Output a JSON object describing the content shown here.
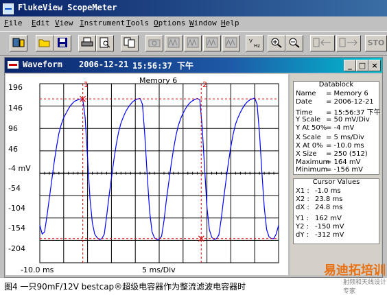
{
  "app": {
    "title": "FlukeView ScopeMeter"
  },
  "menu": [
    "File",
    "Edit",
    "View",
    "Instrument",
    "Tools",
    "Options",
    "Window",
    "Help"
  ],
  "toolbar": {
    "buttons": [
      "instrument-icon",
      "open-icon",
      "save-icon",
      "print-icon",
      "print-preview-icon",
      "copy-icon",
      "camera-icon",
      "waveform-icon",
      "waveform-icon",
      "waveform-icon",
      "waveform-icon",
      "waveform-icon",
      "waveform-icon",
      "vhz-icon",
      "zoom-in-icon",
      "zoom-out-icon",
      "left-arrow-icon",
      "right-arrow-icon"
    ],
    "stop_label": "STO"
  },
  "waveform_window": {
    "title": "Waveform",
    "date": "2006-12-21",
    "time": "15:56:37 下午",
    "controls": {
      "minimize": "_",
      "maximize": "□",
      "close": "×"
    }
  },
  "chart_data": {
    "type": "line",
    "title": "Memory 6",
    "xlabel": "5 ms/Div",
    "x_start_label": "-10.0 ms",
    "y_ticks": [
      "196",
      "146",
      "96",
      "46",
      "-4 mV",
      "-54",
      "-104",
      "-154",
      "-204"
    ],
    "ylim": [
      -204,
      196
    ],
    "xlim_ms": [
      -10,
      40
    ],
    "cursor_labels": [
      "1",
      "2"
    ],
    "cursors": [
      {
        "label": "1",
        "x_ms": -1.0,
        "y_mV": 162
      },
      {
        "label": "2",
        "x_ms": 23.8,
        "y_mV": -150
      }
    ],
    "series": [
      {
        "x": [
          -10,
          -9.5,
          -9,
          -8.5,
          -8,
          -7.5,
          -7,
          -6.5,
          -6,
          -5.5,
          -5,
          -4.5,
          -4,
          -3.5,
          -3,
          -2.5,
          -2,
          -1.5,
          -1,
          -0.5,
          0,
          0.5,
          1,
          1.5,
          2,
          2.5,
          3,
          3.5,
          4,
          4.5,
          5,
          5.5,
          6,
          6.5,
          7,
          7.5,
          8,
          8.5,
          9,
          9.5,
          10,
          10.5,
          11,
          11.5,
          12,
          12.5,
          13,
          13.5,
          14,
          14.5,
          15,
          15.5,
          16,
          16.5,
          17,
          17.5,
          18,
          18.5,
          19,
          19.5,
          20,
          20.5,
          21,
          21.5,
          22,
          22.5,
          23,
          23.5,
          24,
          24.5,
          25,
          25.5,
          26,
          26.5,
          27,
          27.5,
          28,
          28.5,
          29,
          29.5,
          30,
          30.5,
          31,
          31.5,
          32,
          32.5,
          33,
          33.5,
          34,
          34.5,
          35,
          35.5,
          36,
          36.5,
          37,
          37.5,
          38,
          38.5,
          39,
          39.5,
          40
        ],
        "y": [
          -120,
          -140,
          -135,
          -100,
          -60,
          -20,
          20,
          55,
          85,
          105,
          120,
          130,
          140,
          148,
          154,
          158,
          160,
          162,
          162,
          120,
          30,
          -60,
          -115,
          -140,
          -148,
          -152,
          -150,
          -140,
          -100,
          -55,
          -15,
          25,
          60,
          88,
          108,
          122,
          134,
          143,
          150,
          156,
          160,
          162,
          163,
          150,
          80,
          -10,
          -90,
          -135,
          -148,
          -152,
          -151,
          -145,
          -110,
          -65,
          -25,
          15,
          50,
          80,
          102,
          118,
          130,
          140,
          148,
          154,
          158,
          161,
          163,
          160,
          100,
          10,
          -80,
          -130,
          -147,
          -152,
          -150,
          -142,
          -105,
          -60,
          -20,
          20,
          55,
          84,
          106,
          120,
          132,
          142,
          150,
          156,
          160,
          162,
          164,
          150,
          85,
          0,
          -80,
          -130,
          -146,
          -150,
          -150,
          -140,
          -120
        ]
      }
    ]
  },
  "datablock": {
    "title": "Datablock",
    "rows": [
      [
        "Name",
        "= Memory 6"
      ],
      [
        "Date",
        "= 2006-12-21"
      ],
      [
        "Time",
        "= 15:56:37 下午"
      ],
      [
        "Y Scale",
        "=   50  mV/Div"
      ],
      [
        "Y At 50%",
        "=   -4   mV"
      ],
      [
        "X Scale",
        "=    5   ms/Div"
      ],
      [
        "X At 0%",
        "= -10.0 ms"
      ],
      [
        "X Size",
        "= 250 (512)"
      ],
      [
        "Maximum",
        "= 164  mV"
      ],
      [
        "Minimum",
        "= -156  mV"
      ]
    ]
  },
  "cursor_values": {
    "title": "Cursor Values",
    "rows": [
      [
        "X1 :",
        "-1.0 ms"
      ],
      [
        "X2 :",
        "23.8 ms"
      ],
      [
        "dX :",
        "24.8 ms"
      ],
      [
        "Y1 :",
        "162   mV"
      ],
      [
        "Y2 :",
        "-150   mV"
      ],
      [
        "dY :",
        "-312   mV"
      ]
    ]
  },
  "caption": "图4 一只90mF/12V bestcap®超级电容器作为整流滤波电容器时",
  "watermark": {
    "logo": "易迪拓培训",
    "sub": "射频和天线设计专家"
  },
  "colors": {
    "trace": "#0000ff",
    "cursor": "#e00000",
    "grid": "#000000"
  }
}
